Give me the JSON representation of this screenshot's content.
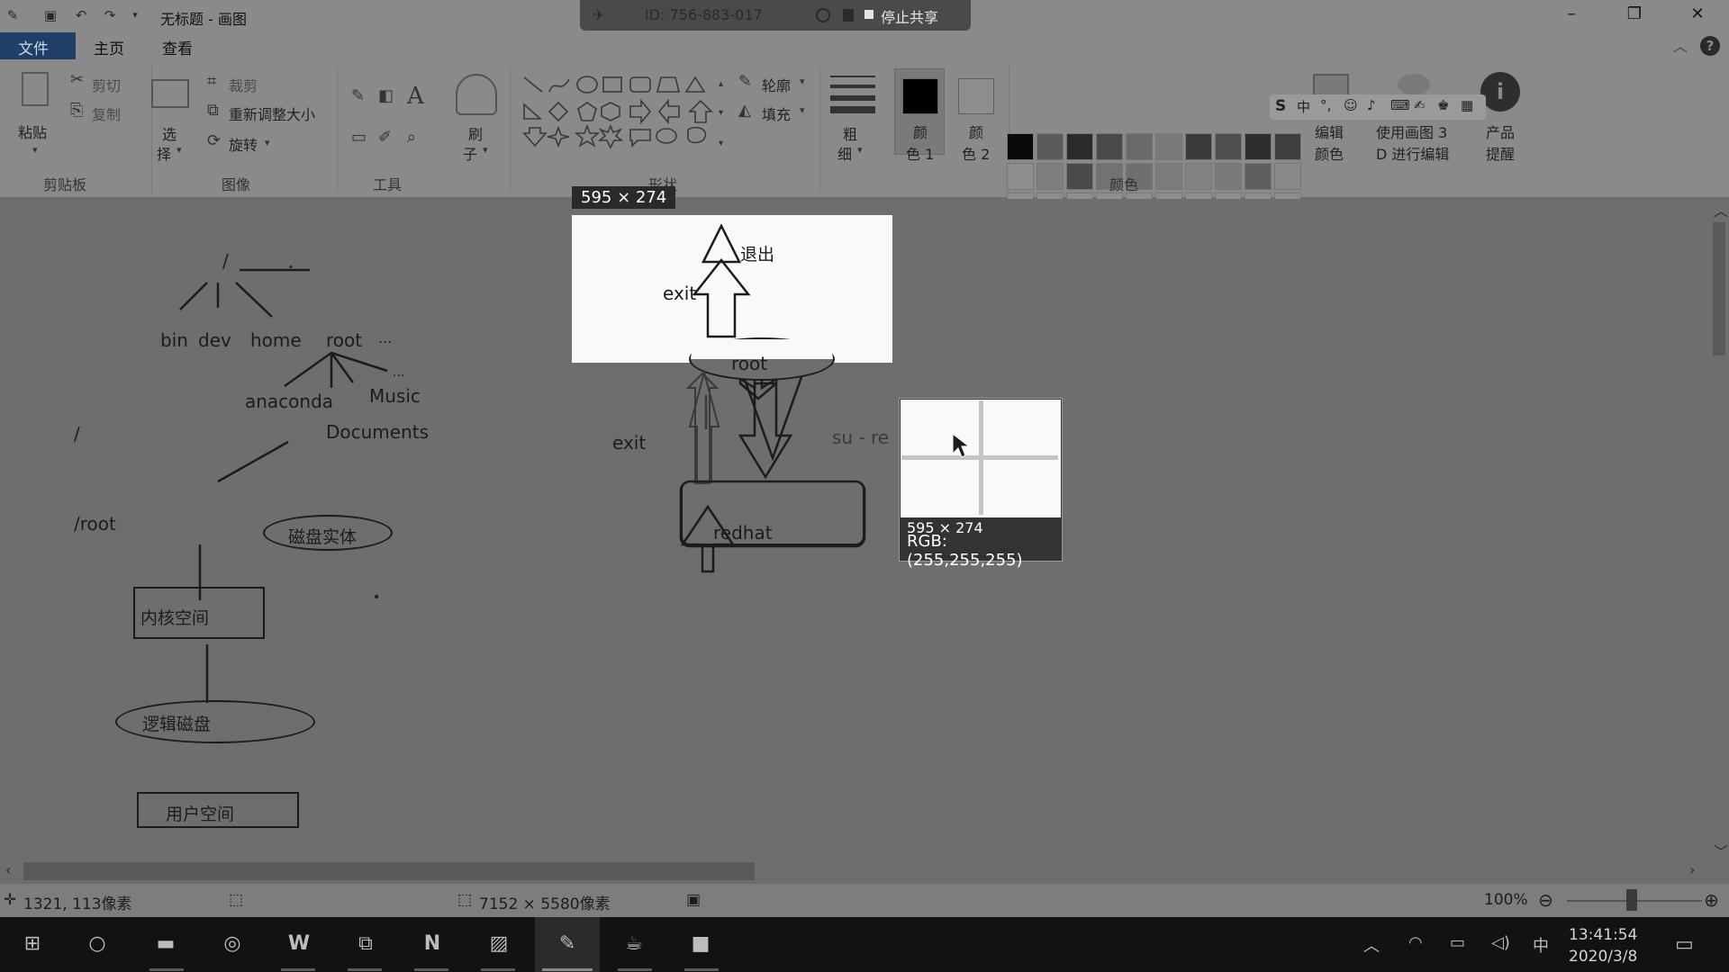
{
  "titlebar": {
    "title": "无标题 - 画图",
    "share_id": "ID: 756-883-017",
    "stop_share": "停止共享"
  },
  "menu": {
    "file": "文件",
    "home": "主页",
    "view": "查看"
  },
  "ribbon": {
    "paste": "粘贴",
    "cut": "剪切",
    "copy": "复制",
    "select": "选",
    "select2": "择",
    "crop": "裁剪",
    "resize": "重新调整大小",
    "rotate": "旋转",
    "brush": "刷",
    "brush2": "子",
    "outline": "轮廓",
    "fill": "填充",
    "size": "粗",
    "size2": "细",
    "color1": "颜",
    "color1b": "色 1",
    "color2": "颜",
    "color2b": "色 2",
    "edit_colors": "编辑",
    "edit_colors2": "颜色",
    "paint3d": "使用画图 3",
    "paint3d2": "D 进行编辑",
    "product": "产品",
    "product2": "提醒",
    "groups": {
      "clipboard": "剪贴板",
      "image": "图像",
      "tools": "工具",
      "shapes": "形状",
      "colors": "颜色"
    }
  },
  "ime": {
    "cn": "中"
  },
  "canvas": {
    "selection_size": "595 × 274",
    "tree_root": "/",
    "dirs": [
      "bin",
      "dev",
      "home",
      "root",
      "..."
    ],
    "subdirs": [
      "anaconda",
      "Music",
      "...",
      "Documents"
    ],
    "slash": "/",
    "root_path": "/root",
    "disk_entity": "磁盘实体",
    "kernel_space": "内核空间",
    "logical_disk": "逻辑磁盘",
    "user_space": "用户空间",
    "exit_label": "退出",
    "exit1": "exit",
    "exit2": "exit",
    "root_node": "root",
    "redhat_node": "redhat",
    "su_text": "su  -  re",
    "magnifier_size": "595 × 274",
    "magnifier_rgb": "RGB:(255,255,255)"
  },
  "status": {
    "cursor_pos": "1321, 113像素",
    "image_size": "7152 × 5580像素",
    "zoom": "100%"
  },
  "clock": {
    "time": "13:41:54",
    "date": "2020/3/8"
  },
  "tray": {
    "ime": "中"
  }
}
